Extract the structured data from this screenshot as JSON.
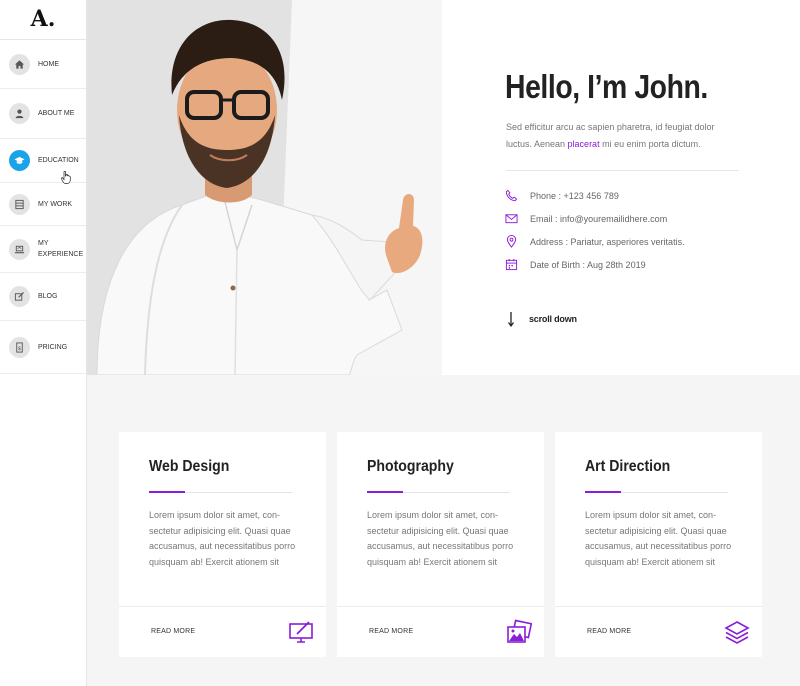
{
  "logo": "A.",
  "nav": [
    {
      "label": "HOME",
      "icon": "home-icon"
    },
    {
      "label": "ABOUT ME",
      "icon": "user-icon"
    },
    {
      "label": "EDUCATION",
      "icon": "graduation-cap-icon",
      "active": true
    },
    {
      "label": "MY WORK",
      "icon": "list-icon"
    },
    {
      "label": "MY EXPERIENCE",
      "icon": "laptop-icon"
    },
    {
      "label": "BLOG",
      "icon": "edit-icon"
    },
    {
      "label": "PRICING",
      "icon": "price-tag-icon"
    }
  ],
  "hero": {
    "title": "Hello, I’m John.",
    "intro_before": "Sed efficitur arcu ac sapien pharetra, id feugiat dolor luctus. Aenean ",
    "intro_accent": "placerat",
    "intro_after": " mi eu enim porta dictum.",
    "phone": "Phone : +123 456 789",
    "email": "Email : info@youremailidhere.com",
    "address": "Address :  Pariatur, asperiores veritatis.",
    "dob": "Date of Birth : Aug 28th 2019",
    "scroll": "scroll down"
  },
  "services": [
    {
      "title": "Web Design",
      "text": "Lorem ipsum dolor sit amet, con-sectetur adipisicing elit. Quasi quae accusamus, aut necessitatibus porro quisquam ab! Exercit ationem sit",
      "cta": "READ MORE",
      "icon": "monitor-edit-icon"
    },
    {
      "title": "Photography",
      "text": "Lorem ipsum dolor sit amet, con-sectetur adipisicing elit. Quasi quae accusamus, aut necessitatibus porro quisquam ab! Exercit ationem sit",
      "cta": "READ MORE",
      "icon": "photos-icon"
    },
    {
      "title": "Art Direction",
      "text": "Lorem ipsum dolor sit amet, con-sectetur adipisicing elit. Quasi quae accusamus, aut necessitatibus porro quisquam ab! Exercit ationem sit",
      "cta": "READ MORE",
      "icon": "layers-icon"
    }
  ],
  "colors": {
    "accent": "#8a1dd6",
    "active_nav": "#1aa3e8",
    "section_bg": "#f5f5f5"
  }
}
